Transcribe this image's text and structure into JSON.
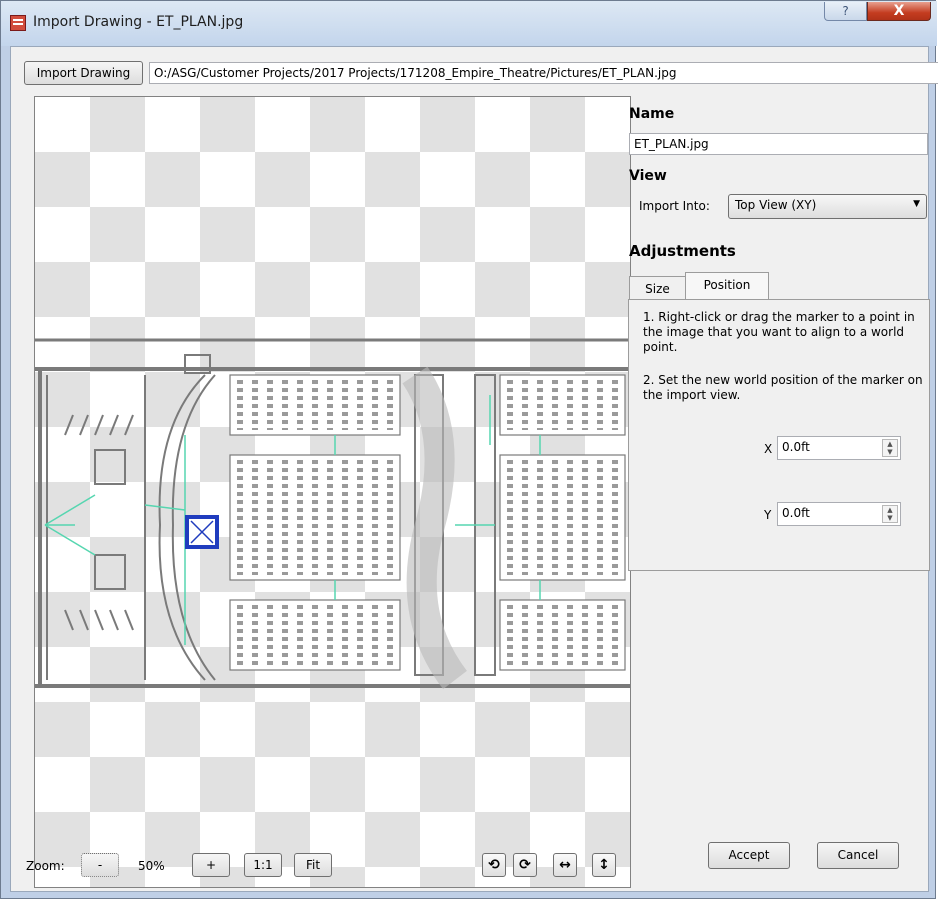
{
  "window": {
    "title": "Import Drawing - ET_PLAN.jpg",
    "help_glyph": "?",
    "close_glyph": "X"
  },
  "import_bar": {
    "button_label": "Import Drawing",
    "path": "O:/ASG/Customer Projects/2017 Projects/171208_Empire_Theatre/Pictures/ET_PLAN.jpg"
  },
  "name_section": {
    "heading": "Name",
    "value": "ET_PLAN.jpg"
  },
  "view_section": {
    "heading": "View",
    "import_into_label": "Import Into:",
    "import_into_value": "Top View (XY)"
  },
  "adjustments": {
    "heading": "Adjustments",
    "tabs": [
      {
        "label": "Size",
        "active": false
      },
      {
        "label": "Position",
        "active": true
      }
    ],
    "instruction_1": "1. Right-click or drag the marker to a point in the image that you want to align to a world point.",
    "instruction_2": "2. Set the new world position of the marker on the import view.",
    "x_label": "X",
    "x_value": "0.0ft",
    "y_label": "Y",
    "y_value": "0.0ft"
  },
  "zoom_bar": {
    "label": "Zoom:",
    "minus_label": "-",
    "value": "50%",
    "plus_label": "+",
    "one_to_one_label": "1:1",
    "fit_label": "Fit"
  },
  "transform_tools": [
    {
      "name": "rotate-ccw",
      "glyph": "⟲"
    },
    {
      "name": "rotate-cw",
      "glyph": "⟳"
    },
    {
      "name": "flip-horizontal",
      "glyph": "↔"
    },
    {
      "name": "flip-vertical",
      "glyph": "↕"
    }
  ],
  "actions": {
    "accept_label": "Accept",
    "cancel_label": "Cancel"
  },
  "colors": {
    "marker": "#1f3cbe",
    "plan_lines": "#7a7a7a",
    "plan_accent": "#56d6b0"
  }
}
